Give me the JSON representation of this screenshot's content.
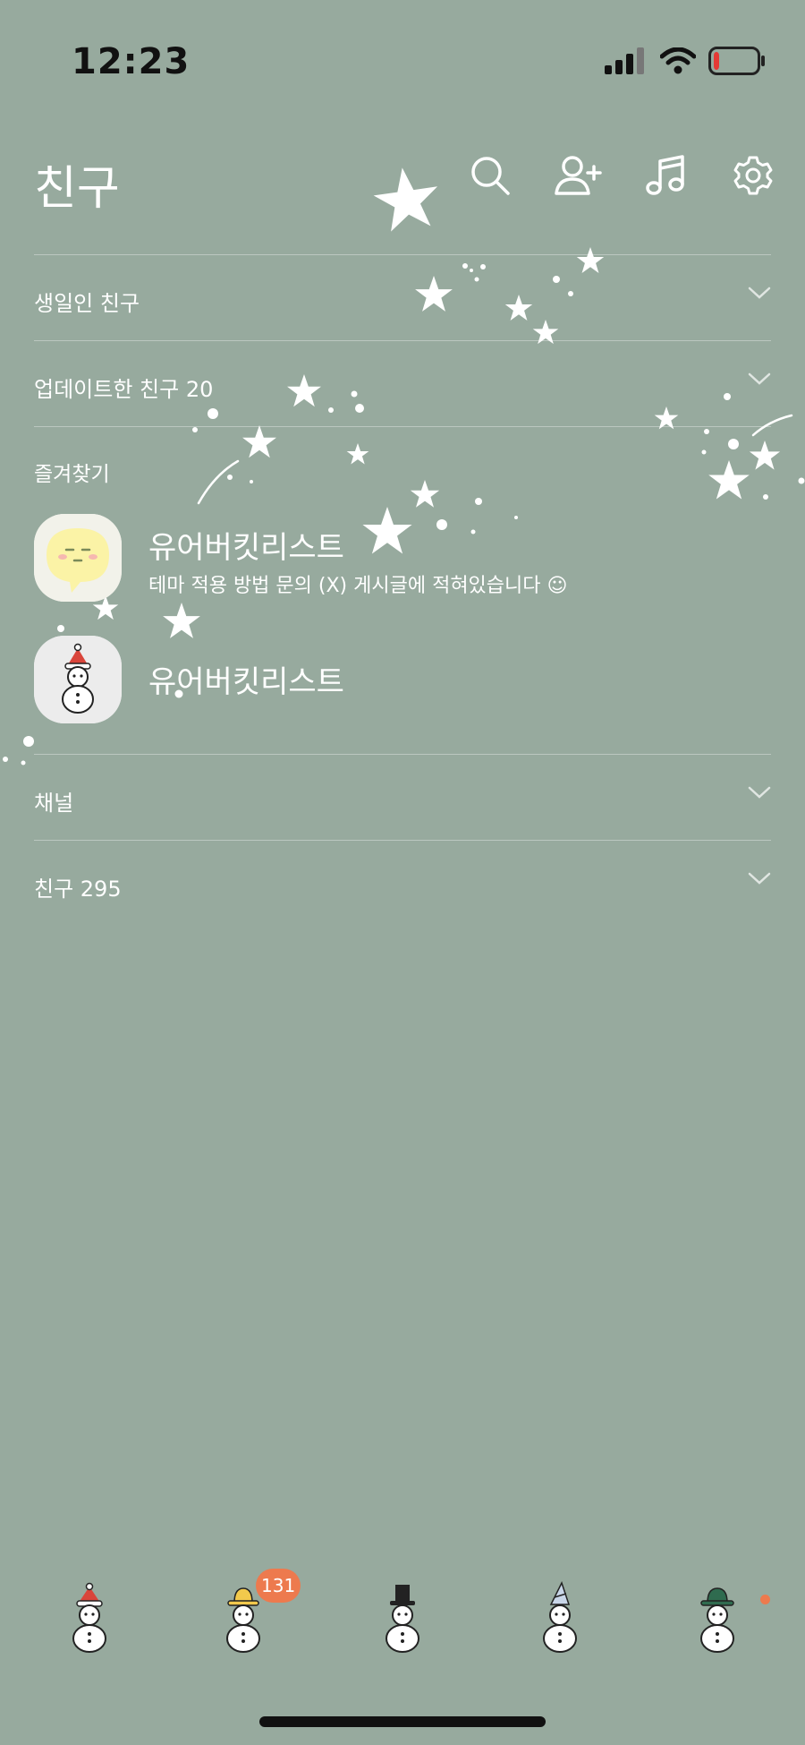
{
  "status_bar": {
    "time": "12:23",
    "battery_level_fraction": 0.1
  },
  "header": {
    "title": "친구"
  },
  "sections": [
    {
      "label": "생일인 친구"
    },
    {
      "label": "업데이트한 친구 20"
    }
  ],
  "favorites": {
    "header": "즐겨찾기",
    "items": [
      {
        "name": "유어버킷리스트",
        "status": "테마 적용 방법 문의 (X) 게시글에 적혀있습니다 ☺",
        "avatar": "speech-bubble-face"
      },
      {
        "name": "유어버킷리스트",
        "status": "",
        "avatar": "snowman"
      }
    ]
  },
  "sections_bottom": [
    {
      "label": "채널"
    },
    {
      "label": "친구 295"
    }
  ],
  "tab_bar": {
    "tabs": [
      {
        "name": "friends",
        "icon": "snowman-red-hat"
      },
      {
        "name": "chats",
        "icon": "snowman-yellow-hat",
        "badge": "131"
      },
      {
        "name": "view",
        "icon": "snowman-top-hat"
      },
      {
        "name": "shopping",
        "icon": "snowman-party-hat"
      },
      {
        "name": "more",
        "icon": "snowman-green-hat"
      }
    ]
  },
  "colors": {
    "background": "#97aa9e",
    "accent_badge": "#ed7a4e",
    "text": "#ffffff",
    "battery_low": "#e53935"
  }
}
